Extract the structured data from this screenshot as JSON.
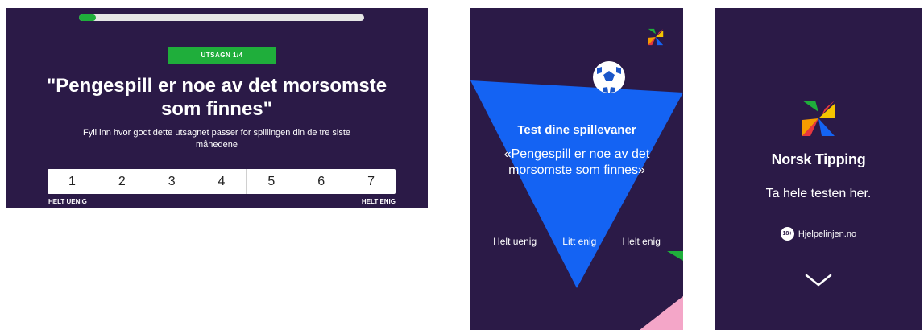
{
  "survey": {
    "progress": 0.06,
    "step_label": "UTSAGN 1/4",
    "statement": "\"Pengespill er noe av det morsomste som finnes\"",
    "instruction": "Fyll inn hvor godt dette utsagnet passer for spillingen din de tre siste månedene",
    "scale": [
      "1",
      "2",
      "3",
      "4",
      "5",
      "6",
      "7"
    ],
    "label_left": "HELT UENIG",
    "label_right": "HELT ENIG"
  },
  "ad": {
    "title": "Test dine spillevaner",
    "quote": "«Pengespill er noe av det morsomste som finnes»",
    "answers": [
      "Helt uenig",
      "Litt enig",
      "Helt enig"
    ]
  },
  "brand_frame": {
    "brand": "Norsk Tipping",
    "cta": "Ta hele testen her.",
    "age_badge": "18+",
    "help_link": "Hjelpelinjen.no"
  },
  "colors": {
    "background": "#2b1a47",
    "accent_green": "#1fae3b",
    "ad_blue": "#1463f3",
    "pink": "#f4a6c8"
  },
  "icons": [
    "norsk-tipping-logo-icon",
    "football-icon",
    "chevron-down-icon"
  ]
}
